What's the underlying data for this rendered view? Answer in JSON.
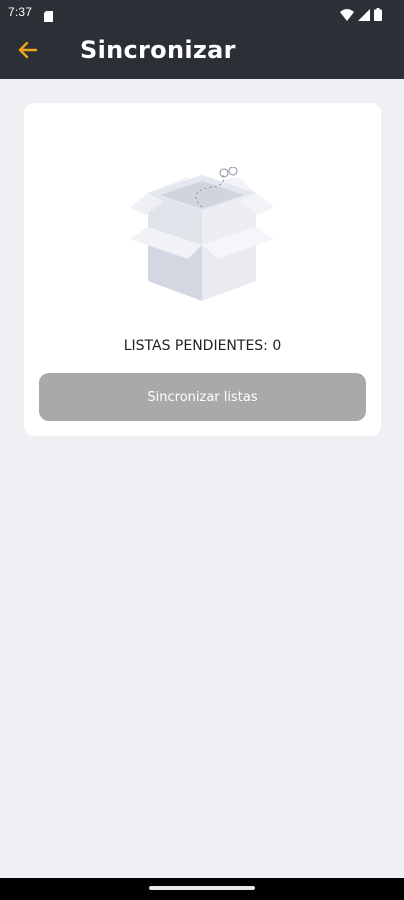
{
  "status_bar": {
    "time": "7:37",
    "icons": [
      "sd-card-icon",
      "wifi-icon",
      "signal-icon",
      "battery-icon"
    ]
  },
  "app_bar": {
    "title": "Sincronizar",
    "back_icon": "arrow-left-icon",
    "back_icon_color": "#f0a21b",
    "background": "#2b2f36"
  },
  "card": {
    "illustration": "empty-box-icon",
    "pending_label": "LISTAS PENDIENTES: 0",
    "button_label": "Sincronizar listas",
    "button_color": "#a9a9a9"
  },
  "nav_bar": {
    "home_indicator": "home-indicator"
  }
}
